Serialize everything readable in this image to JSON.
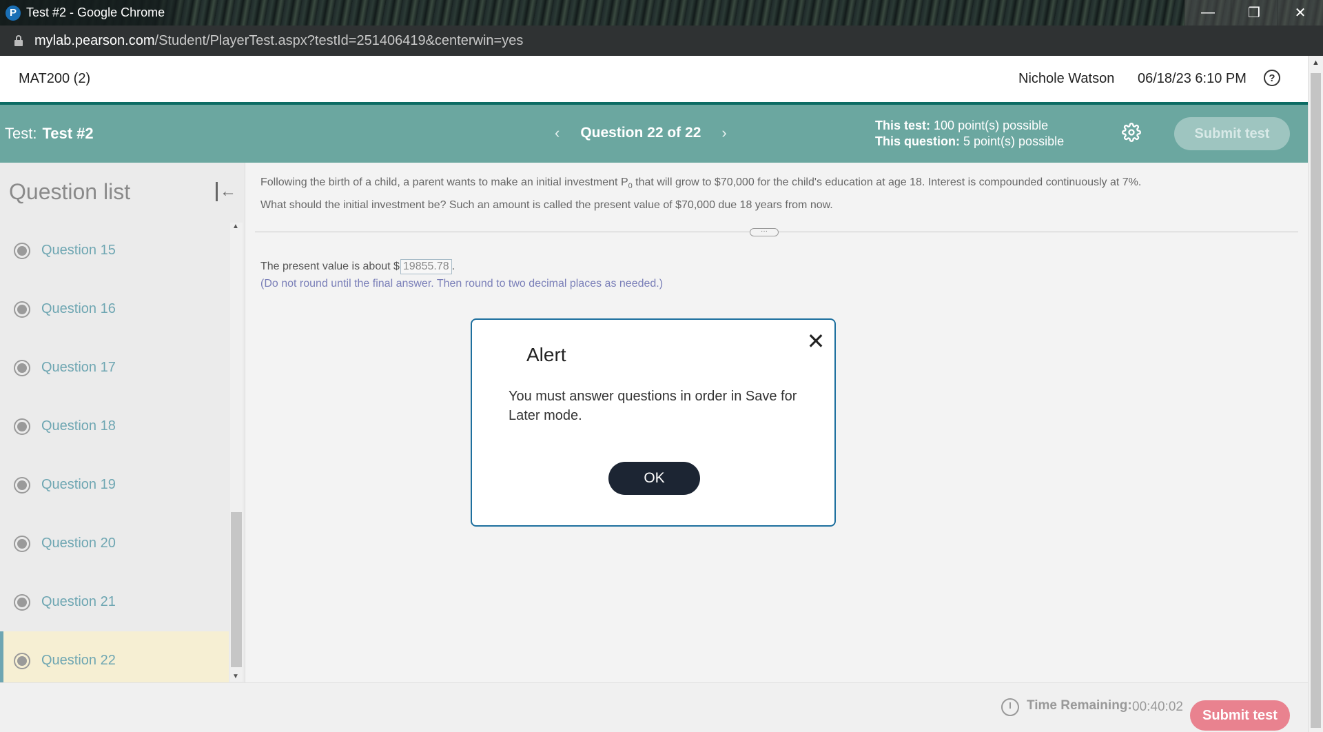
{
  "window": {
    "title": "Test #2 - Google Chrome",
    "logo_letter": "P",
    "controls": {
      "minimize": "—",
      "restore": "❐",
      "close": "✕"
    }
  },
  "addressbar": {
    "url_host": "mylab.pearson.com",
    "url_path": "/Student/PlayerTest.aspx?testId=251406419&centerwin=yes"
  },
  "header": {
    "course": "MAT200 (2)",
    "user": "Nichole Watson",
    "datetime": "06/18/23 6:10 PM",
    "help_glyph": "?"
  },
  "testbar": {
    "test_prefix": "Test:",
    "test_name": "Test #2",
    "question_indicator": "Question 22 of 22",
    "prev_glyph": "‹",
    "next_glyph": "›",
    "test_points_label": "This test:",
    "test_points_value": "100 point(s) possible",
    "question_points_label": "This question:",
    "question_points_value": "5 point(s) possible",
    "submit_label": "Submit test"
  },
  "sidebar": {
    "title": "Question list",
    "questions": [
      {
        "label": "Question 15"
      },
      {
        "label": "Question 16"
      },
      {
        "label": "Question 17"
      },
      {
        "label": "Question 18"
      },
      {
        "label": "Question 19"
      },
      {
        "label": "Question 20"
      },
      {
        "label": "Question 21"
      },
      {
        "label": "Question 22"
      }
    ],
    "active_question": "Question 22"
  },
  "question": {
    "text_part1": "Following the birth of a child, a parent wants to make an initial investment P",
    "subscript": "0",
    "text_part2": " that will grow to $70,000 for the child's education at age 18. Interest is compounded continuously at 7%.",
    "text_line2": "What should the initial investment be? Such an amount is called the present value of $70,000 due 18 years from now.",
    "answer_prefix": "The present value is about $",
    "answer_value": "19855.78",
    "answer_suffix": ".",
    "hint": "(Do not round until the final answer. Then round to two decimal places as needed.)"
  },
  "modal": {
    "title": "Alert",
    "message": "You must answer questions in order in Save for Later mode.",
    "ok_label": "OK",
    "close_glyph": "✕"
  },
  "footer": {
    "time_label": "Time Remaining:",
    "time_value": "00:40:02",
    "submit_label": "Submit test"
  },
  "colors": {
    "accent_teal": "#6ba7a0",
    "dark_teal": "#0b6b63",
    "submit_pink": "#e9828f",
    "modal_border": "#1d6f9e",
    "ok_button": "#1c2533",
    "question_link": "#6ea6b2",
    "active_row": "#f6efd3"
  }
}
